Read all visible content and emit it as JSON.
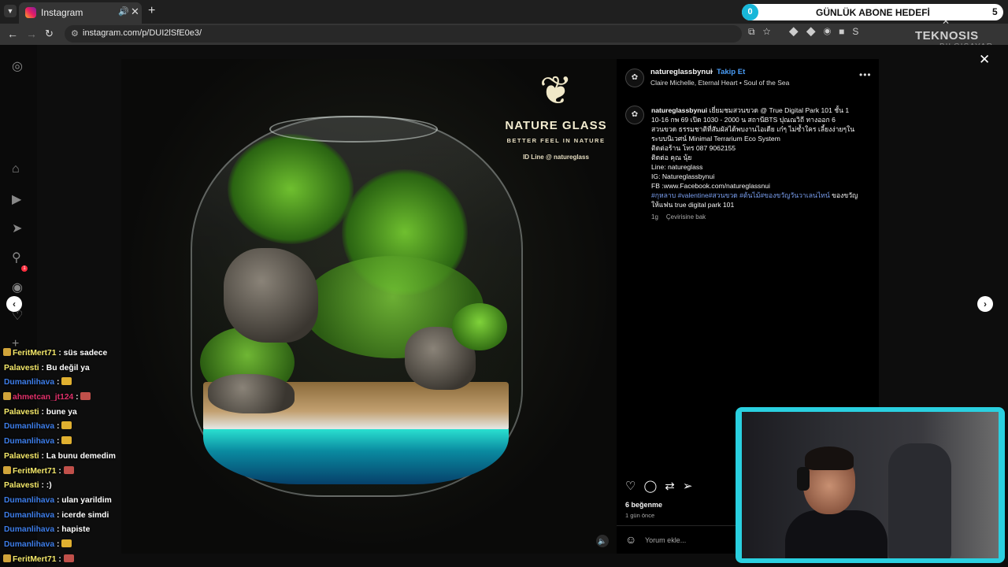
{
  "browser": {
    "tab_title": "Instagram",
    "url": "instagram.com/p/DUI2lSfE0e3/",
    "new_tab": "+",
    "close_tab": "✕"
  },
  "overlay": {
    "goal_count": "0",
    "goal_title": "GÜNLÜK ABONE HEDEFİ",
    "goal_target": "5",
    "brand_line1": "TEKNOSIS",
    "brand_line2": "BILGISAYAR"
  },
  "rail": {
    "notification_count": "1",
    "icons": [
      "instagram-logo-icon",
      "home-icon",
      "reels-icon",
      "messages-icon",
      "search-icon",
      "explore-icon",
      "notifications-icon",
      "create-icon"
    ]
  },
  "media": {
    "logo_line1": "NATURE GLASS",
    "logo_line2": "BETTER FEEL IN NATURE",
    "logo_line3": "ID Line @ natureglass"
  },
  "post": {
    "account": "natureglassbynui",
    "separator": "•",
    "follow_label": "Takip Et",
    "audio": "Claire Michelle, Eternal Heart • Soul of the Sea",
    "caption_user": "natureglassbynui",
    "caption_lines": [
      "เยี่ยมชมสวนขวด @ True Digital Park 101 ชั้น 1",
      "10-16 กพ 69 เปิด 1030 - 2000 น สถานีBTS ปุณณวิถี ทางออก 6",
      "สวนขวด ธรรมชาติที่สัมผัสได้พบงานไอเดีย เก๋ๆ ไม่ซ้ำใคร เลี้ยงง่ายๆในระบบนิเวศน์ Minimal Terrarium Eco System",
      "ติดต่อร้าน โทร 087 9062155",
      "ติดต่อ คุณ นุ้ย",
      "Line: natureglass",
      "IG: Natureglassbynui",
      "FB :www.Facebook.com/natureglassnui"
    ],
    "caption_tags": "#กุหลาบ #valentine#สวนขวด #ต้นไม้#ของขวัญวันวาเลนไทน์",
    "caption_tail": " ของขวัญให้แฟน true digital park 101",
    "age_short": "1g",
    "see_translation": "Çevirisine bak",
    "likes": "6 beğenme",
    "time_ago": "1 gün önce",
    "comment_placeholder": "Yorum ekle..."
  },
  "chat": [
    {
      "badge": true,
      "user": "FeritMert71",
      "color": "#f4e86a",
      "text": " : süs sadece",
      "emote": ""
    },
    {
      "badge": false,
      "user": "Palavesti",
      "color": "#f4e86a",
      "text": " : Bu değil ya",
      "emote": ""
    },
    {
      "badge": false,
      "user": "Dumanlihava",
      "color": "#3d7de8",
      "text": " : ",
      "emote": "#e0b030"
    },
    {
      "badge": true,
      "user": "ahmetcan_jt124",
      "color": "#e0306a",
      "text": " : ",
      "emote": "#c0504a"
    },
    {
      "badge": false,
      "user": "Palavesti",
      "color": "#f4e86a",
      "text": " : bune ya",
      "emote": ""
    },
    {
      "badge": false,
      "user": "Dumanlihava",
      "color": "#3d7de8",
      "text": " : ",
      "emote": "#e0b030"
    },
    {
      "badge": false,
      "user": "Dumanlihava",
      "color": "#3d7de8",
      "text": " : ",
      "emote": "#e0b030"
    },
    {
      "badge": false,
      "user": "Palavesti",
      "color": "#f4e86a",
      "text": " : La bunu demedim",
      "emote": ""
    },
    {
      "badge": true,
      "user": "FeritMert71",
      "color": "#f4e86a",
      "text": " : ",
      "emote": "#c0504a"
    },
    {
      "badge": false,
      "user": "Palavesti",
      "color": "#f4e86a",
      "text": " : :)",
      "emote": ""
    },
    {
      "badge": false,
      "user": "Dumanlihava",
      "color": "#3d7de8",
      "text": " : ulan yarildim",
      "emote": ""
    },
    {
      "badge": false,
      "user": "Dumanlihava",
      "color": "#3d7de8",
      "text": " : icerde simdi",
      "emote": ""
    },
    {
      "badge": false,
      "user": "Dumanlihava",
      "color": "#3d7de8",
      "text": " : hapiste",
      "emote": ""
    },
    {
      "badge": false,
      "user": "Dumanlihava",
      "color": "#3d7de8",
      "text": " : ",
      "emote": "#e0b030"
    },
    {
      "badge": true,
      "user": "FeritMert71",
      "color": "#f4e86a",
      "text": " : ",
      "emote": "#c0504a"
    }
  ]
}
